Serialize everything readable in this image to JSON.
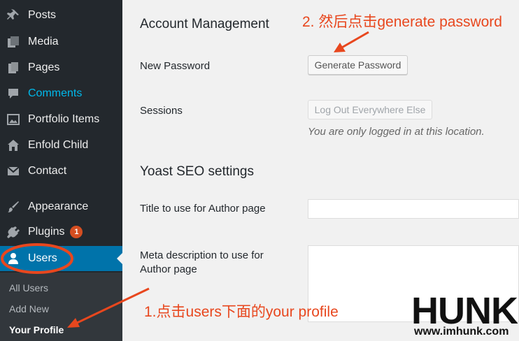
{
  "sidebar": {
    "items": [
      {
        "label": "Posts",
        "icon": "pin-icon"
      },
      {
        "label": "Media",
        "icon": "media-icon"
      },
      {
        "label": "Pages",
        "icon": "pages-icon"
      },
      {
        "label": "Comments",
        "icon": "comments-icon"
      },
      {
        "label": "Portfolio Items",
        "icon": "portfolio-icon"
      },
      {
        "label": "Enfold Child",
        "icon": "home-icon"
      },
      {
        "label": "Contact",
        "icon": "mail-icon"
      },
      {
        "label": "Appearance",
        "icon": "brush-icon"
      },
      {
        "label": "Plugins",
        "icon": "plugin-icon",
        "badge": "1"
      },
      {
        "label": "Users",
        "icon": "user-icon"
      }
    ],
    "submenu": [
      "All Users",
      "Add New",
      "Your Profile"
    ]
  },
  "main": {
    "account_heading": "Account Management",
    "new_password_label": "New Password",
    "generate_button": "Generate Password",
    "sessions_label": "Sessions",
    "logout_button": "Log Out Everywhere Else",
    "sessions_desc": "You are only logged in at this location.",
    "yoast_heading": "Yoast SEO settings",
    "author_title_label": "Title to use for Author page",
    "meta_desc_label_line1": "Meta description to use for",
    "meta_desc_label_line2": "Author page"
  },
  "annotations": {
    "step2": "2. 然后点击generate password",
    "step1": "1.点击users下面的your profile"
  },
  "watermark": {
    "logo": "HUNK",
    "url": "www.imhunk.com"
  },
  "colors": {
    "annotation": "#e8471e",
    "sidebar_bg": "#23282d",
    "active_bg": "#0073aa"
  }
}
